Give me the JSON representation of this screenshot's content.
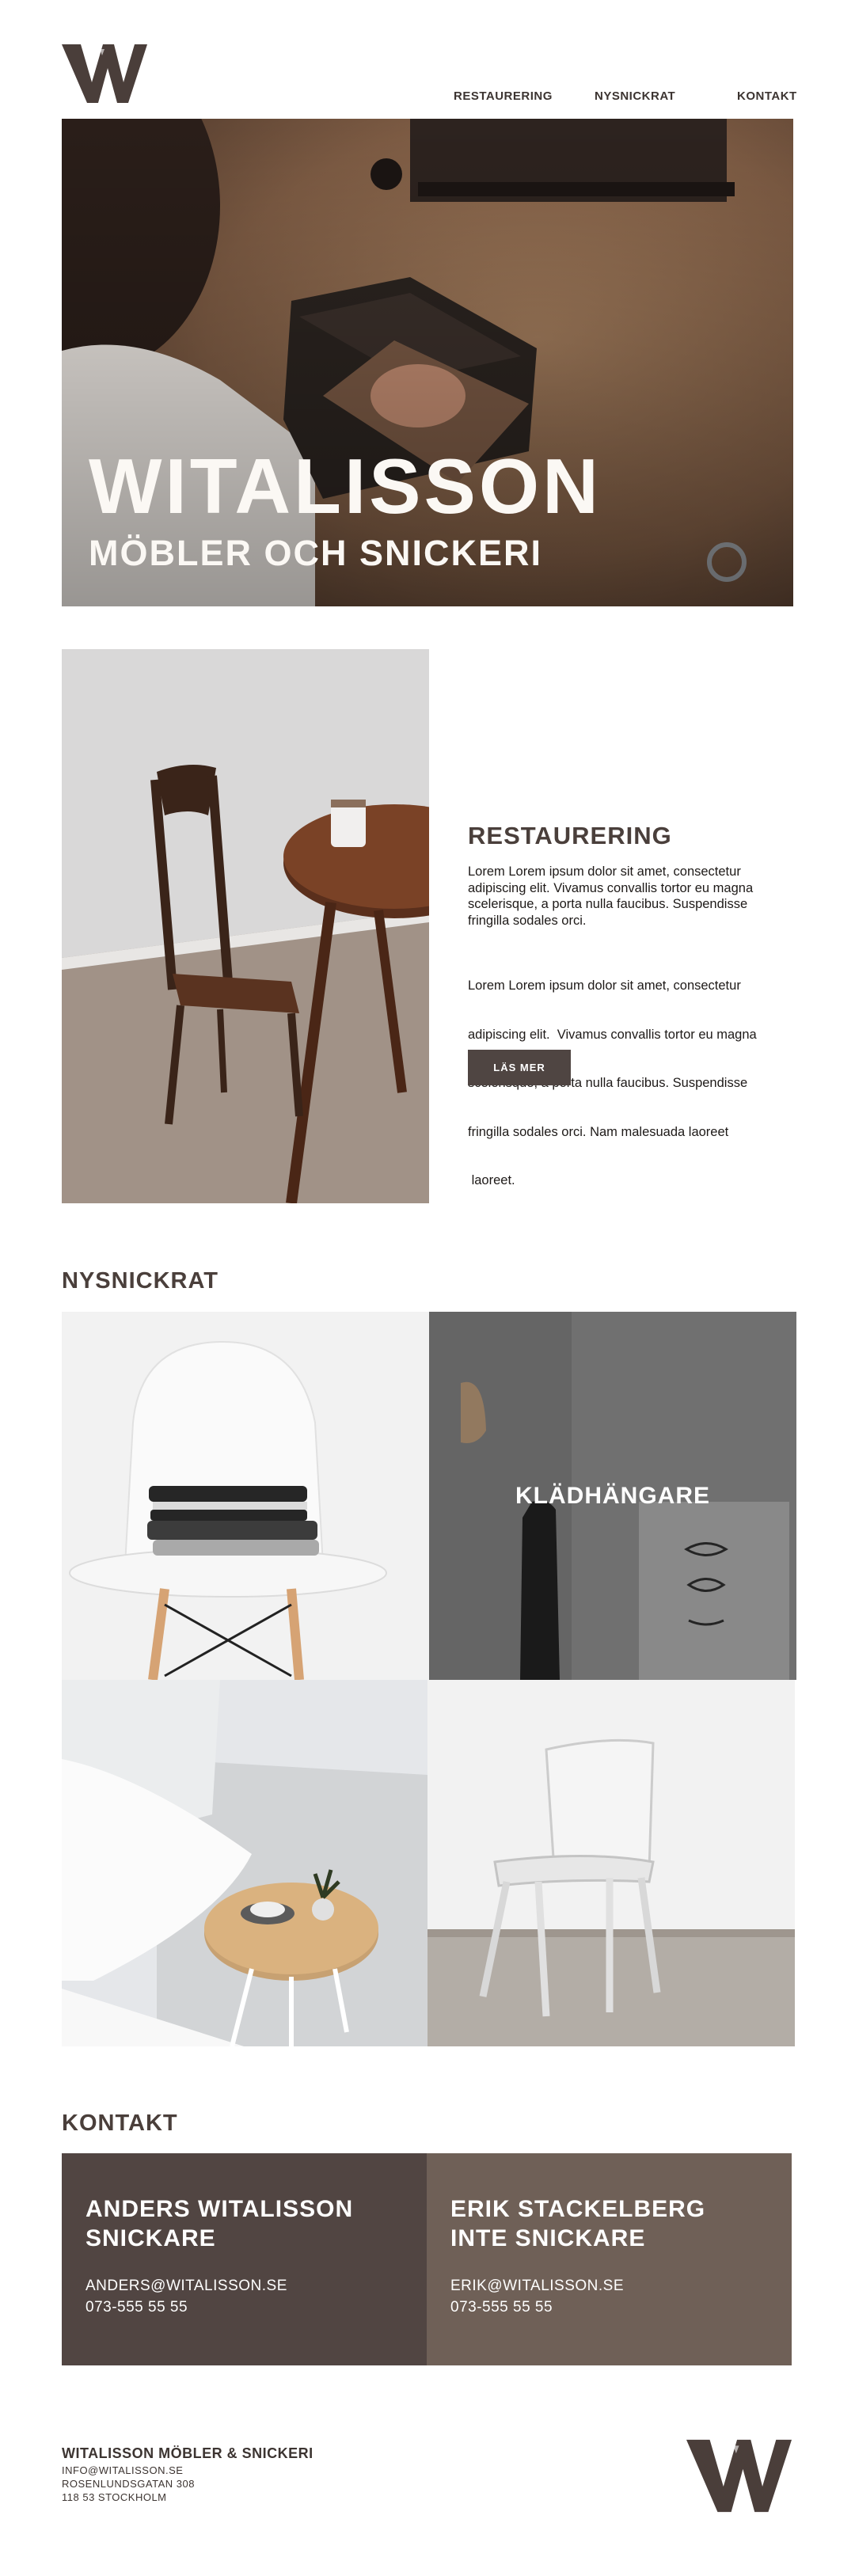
{
  "nav": {
    "items": [
      {
        "label": "RESTAURERING"
      },
      {
        "label": "NYSNICKRAT"
      },
      {
        "label": "KONTAKT"
      }
    ]
  },
  "hero": {
    "title": "WITALISSON",
    "subtitle": "MÖBLER OCH SNICKERI"
  },
  "restaurering": {
    "heading": "RESTAURERING",
    "paragraph_1_lines": [
      "Lorem Lorem ipsum dolor sit amet, consectetur",
      "adipiscing elit. Vivamus convallis tortor eu magna",
      "scelerisque, a porta nulla faucibus. Suspendisse",
      "fringilla sodales orci."
    ],
    "paragraph_2_lines": [
      "Lorem Lorem ipsum dolor sit amet, consectetur",
      "adipiscing elit.  Vivamus convallis tortor eu magna",
      "scelerisque, a porta nulla faucibus. Suspendisse",
      "fringilla sodales orci. Nam malesuada laoreet",
      " laoreet."
    ],
    "button_label": "LÄS MER"
  },
  "nysnickrat": {
    "heading": "NYSNICKRAT",
    "tile_label": "KLÄDHÄNGARE"
  },
  "kontakt": {
    "heading": "KONTAKT",
    "cards": [
      {
        "name": "ANDERS WITALISSON",
        "role": "SNICKARE",
        "email": "ANDERS@WITALISSON.SE",
        "phone": "073-555 55 55"
      },
      {
        "name": "ERIK STACKELBERG",
        "role": "INTE SNICKARE",
        "email": "ERIK@WITALISSON.SE",
        "phone": "073-555 55 55"
      }
    ]
  },
  "footer": {
    "company": "WITALISSON MÖBLER & SNICKERI",
    "email": "INFO@WITALISSON.SE",
    "street": "ROSENLUNDSGATAN 308",
    "city": "118 53 STOCKHOLM"
  },
  "colors": {
    "brand_dark": "#4f4542",
    "card_left": "#514542",
    "card_right": "#6f6057",
    "heading_text": "#4a3f3b"
  },
  "icons": {
    "logo": "w-monogram-logo",
    "footer_logo": "w-monogram-logo"
  }
}
